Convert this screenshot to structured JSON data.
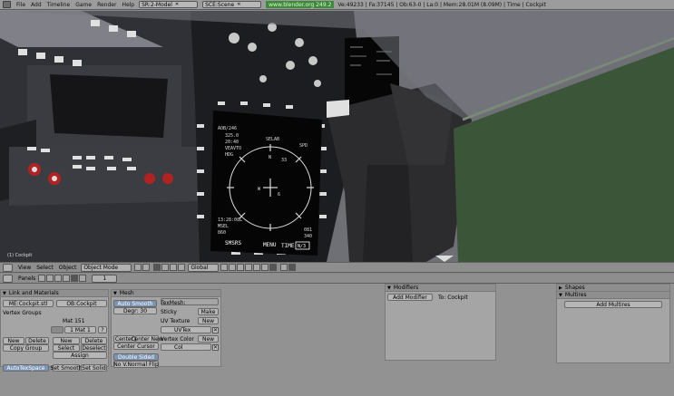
{
  "topbar": {
    "menus": [
      "File",
      "Add",
      "Timeline",
      "Game",
      "Render",
      "Help"
    ],
    "screen_select": "SR:2-Model",
    "scene_select": "SCE:Scene",
    "url": "www.blender.org 249.2",
    "stats": "Ve:49233 | Fa:37145 | Ob:63-0 | La:0  | Mem:28.01M (8.09M) | Time | Cockpit"
  },
  "viewport": {
    "object_label": "(1) Cockpit",
    "mfd": {
      "top_left": "AOB/246",
      "hdg_small": "325.0",
      "r1": "SELAB",
      "r2": "SPD",
      "l1": "20:40",
      "l2": "VEAVTO",
      "l3": "HDG",
      "time": "13:28:08L",
      "msel": "MSEL",
      "alt": "860",
      "ref": "081",
      "brg": "340",
      "n1": "N",
      "n2": "33",
      "n3": "6",
      "n4": "W",
      "bottom": [
        "SMSRS",
        "MENU",
        "TIME"
      ],
      "pg": "N/3"
    }
  },
  "header3d": {
    "menus": [
      "View",
      "Select",
      "Object"
    ],
    "mode": "Object Mode",
    "orient": "Global"
  },
  "buttons_header": {
    "panels_label": "Panels",
    "frame": "1"
  },
  "panels": {
    "link": {
      "title": "Link and Materials",
      "mesh_name": "ME:Cockpit.stl",
      "ob_name": "OB:Cockpit",
      "vertex_groups": "Vertex Groups",
      "mat": "Mat 151",
      "mat_slot": "1 Mat 1",
      "q": "?",
      "new": "New",
      "delete": "Delete",
      "copy_group": "Copy Group",
      "select": "Select",
      "deselect": "Deselect",
      "assign": "Assign",
      "autotex": "AutoTexSpace",
      "set_smooth": "Set Smooth",
      "set_solid": "Set Solid"
    },
    "mesh": {
      "title": "Mesh",
      "auto_smooth": "Auto Smooth",
      "degr": "Degr: 30",
      "texmesh": "TexMesh:",
      "sticky": "Sticky",
      "make": "Make",
      "uv_texture": "UV Texture",
      "new": "New",
      "uvtex": "UVTex",
      "vertex_color": "Vertex Color",
      "col": "Col",
      "center": "Center",
      "center_new": "Center New",
      "center_cursor": "Center Cursor",
      "double_sided": "Double Sided",
      "no_v_normal_flip": "No V.Normal Flip"
    },
    "modifiers": {
      "title": "Modifiers",
      "add": "Add Modifier",
      "to": "To: Cockpit"
    },
    "shapes": {
      "title": "Shapes"
    },
    "multires": {
      "title": "Multires",
      "add": "Add Multires"
    }
  },
  "colors": {
    "topbar": "#9c9c9c",
    "viewport_bg": "#7a7a80",
    "green_panel": "#3a5538",
    "mfd_bg": "#050505"
  }
}
